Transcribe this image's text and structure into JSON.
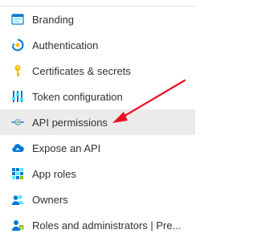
{
  "nav": {
    "items": [
      {
        "label": "Branding",
        "icon": "branding-icon",
        "selected": false
      },
      {
        "label": "Authentication",
        "icon": "authentication-icon",
        "selected": false
      },
      {
        "label": "Certificates & secrets",
        "icon": "key-icon",
        "selected": false
      },
      {
        "label": "Token configuration",
        "icon": "token-configuration-icon",
        "selected": false
      },
      {
        "label": "API permissions",
        "icon": "api-permissions-icon",
        "selected": true
      },
      {
        "label": "Expose an API",
        "icon": "cloud-icon",
        "selected": false
      },
      {
        "label": "App roles",
        "icon": "app-roles-icon",
        "selected": false
      },
      {
        "label": "Owners",
        "icon": "owners-icon",
        "selected": false
      },
      {
        "label": "Roles and administrators | Pre...",
        "icon": "roles-administrators-icon",
        "selected": false
      }
    ]
  },
  "colors": {
    "text": "#323130",
    "selected_background": "#edebe9",
    "annotation_arrow": "#e81123",
    "azure_blue": "#0078d4",
    "key_yellow": "#ffb900"
  },
  "annotation": {
    "target": "API permissions"
  }
}
